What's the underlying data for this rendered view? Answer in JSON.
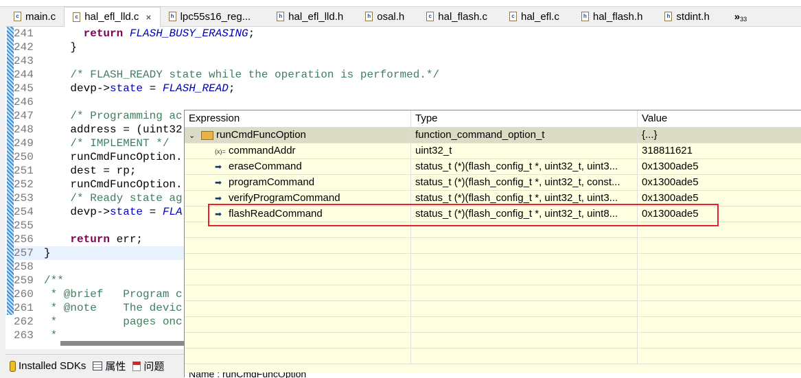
{
  "tabs": [
    {
      "label": "main.c",
      "type": "c"
    },
    {
      "label": "hal_efl_lld.c",
      "type": "c",
      "active": true
    },
    {
      "label": "lpc55s16_reg...",
      "type": "h"
    },
    {
      "label": "hal_efl_lld.h",
      "type": "h"
    },
    {
      "label": "osal.h",
      "type": "h"
    },
    {
      "label": "hal_flash.c",
      "type": "c"
    },
    {
      "label": "hal_efl.c",
      "type": "c"
    },
    {
      "label": "hal_flash.h",
      "type": "h"
    },
    {
      "label": "stdint.h",
      "type": "h"
    }
  ],
  "tabs_overflow": "»",
  "tabs_overflow_count": "33",
  "code": {
    "lines": [
      {
        "n": "241",
        "t": "      return FLASH_BUSY_ERASING;"
      },
      {
        "n": "242",
        "t": "    }"
      },
      {
        "n": "243",
        "t": ""
      },
      {
        "n": "244",
        "t": "    /* FLASH_READY state while the operation is performed.*/"
      },
      {
        "n": "245",
        "t": "    devp->state = FLASH_READ;"
      },
      {
        "n": "246",
        "t": ""
      },
      {
        "n": "247",
        "t": "    /* Programming ac"
      },
      {
        "n": "248",
        "t": "    address = (uint32"
      },
      {
        "n": "249",
        "t": "    /* IMPLEMENT */"
      },
      {
        "n": "250",
        "t": "    runCmdFuncOption."
      },
      {
        "n": "251",
        "t": "    dest = rp;"
      },
      {
        "n": "252",
        "t": "    runCmdFuncOption."
      },
      {
        "n": "253",
        "t": "    /* Ready state ag"
      },
      {
        "n": "254",
        "t": "    devp->state = FLA"
      },
      {
        "n": "255",
        "t": ""
      },
      {
        "n": "256",
        "t": "    return err;"
      },
      {
        "n": "257",
        "t": "}"
      },
      {
        "n": "258",
        "t": ""
      },
      {
        "n": "259",
        "t": "/**"
      },
      {
        "n": "260",
        "t": " * @brief   Program c"
      },
      {
        "n": "261",
        "t": " * @note    The devic"
      },
      {
        "n": "262",
        "t": " *          pages onc"
      },
      {
        "n": "263",
        "t": " *"
      }
    ]
  },
  "bottom_tabs": [
    "Installed SDKs",
    "属性",
    "问题"
  ],
  "expressions": {
    "headers": [
      "Expression",
      "Type",
      "Value"
    ],
    "root": {
      "name": "runCmdFuncOption",
      "type": "function_command_option_t",
      "value": "{...}"
    },
    "children": [
      {
        "name": "commandAddr",
        "type": "uint32_t",
        "value": "318811621",
        "icon": "variable"
      },
      {
        "name": "eraseCommand",
        "type": "status_t (*)(flash_config_t *, uint32_t, uint3...",
        "value": "0x1300ade5",
        "icon": "pointer"
      },
      {
        "name": "programCommand",
        "type": "status_t (*)(flash_config_t *, uint32_t, const...",
        "value": "0x1300ade5",
        "icon": "pointer"
      },
      {
        "name": "verifyProgramCommand",
        "type": "status_t (*)(flash_config_t *, uint32_t, uint3...",
        "value": "0x1300ade5",
        "icon": "pointer"
      },
      {
        "name": "flashReadCommand",
        "type": "status_t (*)(flash_config_t *, uint32_t, uint8...",
        "value": "0x1300ade5",
        "icon": "pointer",
        "highlighted": true
      }
    ],
    "name_line": "Name : runCmdFuncOption",
    "highlight_color": "#e8202a"
  }
}
